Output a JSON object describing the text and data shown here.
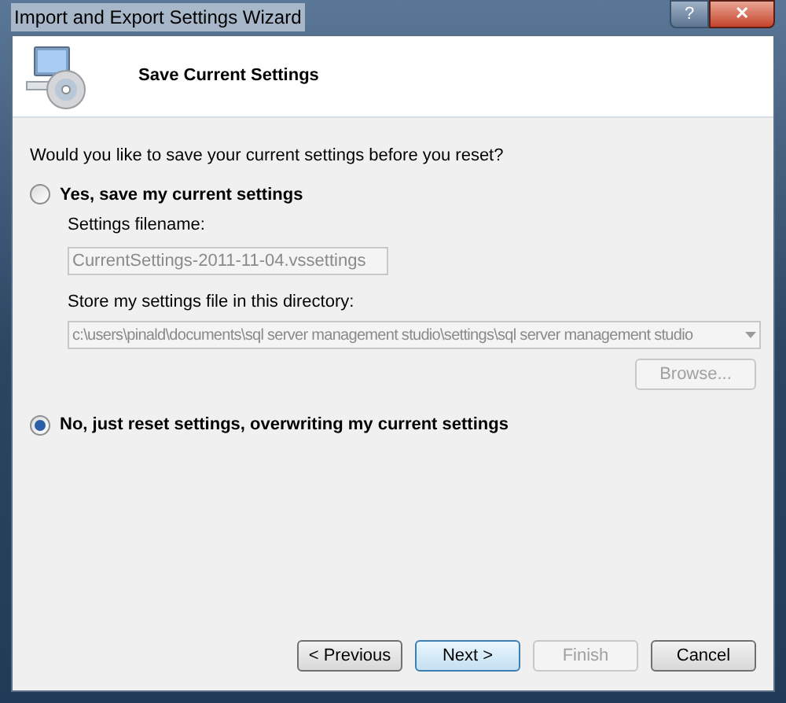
{
  "window": {
    "title": "Import and Export Settings Wizard",
    "help": "?",
    "close": "✕"
  },
  "header": {
    "title": "Save Current Settings"
  },
  "question": "Would you like to save your current settings before you reset?",
  "options": [
    {
      "label": "Yes, save my current settings",
      "selected": false
    },
    {
      "label": "No, just reset settings, overwriting my current settings",
      "selected": true
    }
  ],
  "filename": {
    "label": "Settings filename:",
    "value": "CurrentSettings-2011-11-04.vssettings",
    "disabled": true
  },
  "directory": {
    "label": "Store my settings file in this directory:",
    "value": "c:\\users\\pinald\\documents\\sql server management studio\\settings\\sql server management studio",
    "disabled": true
  },
  "browse": {
    "label": "Browse...",
    "disabled": true
  },
  "buttons": [
    {
      "label": "< Previous",
      "disabled": false,
      "selected": false
    },
    {
      "label": "Next >",
      "disabled": false,
      "selected": true
    },
    {
      "label": "Finish",
      "disabled": true,
      "selected": false
    },
    {
      "label": "Cancel",
      "disabled": false,
      "selected": false
    }
  ]
}
